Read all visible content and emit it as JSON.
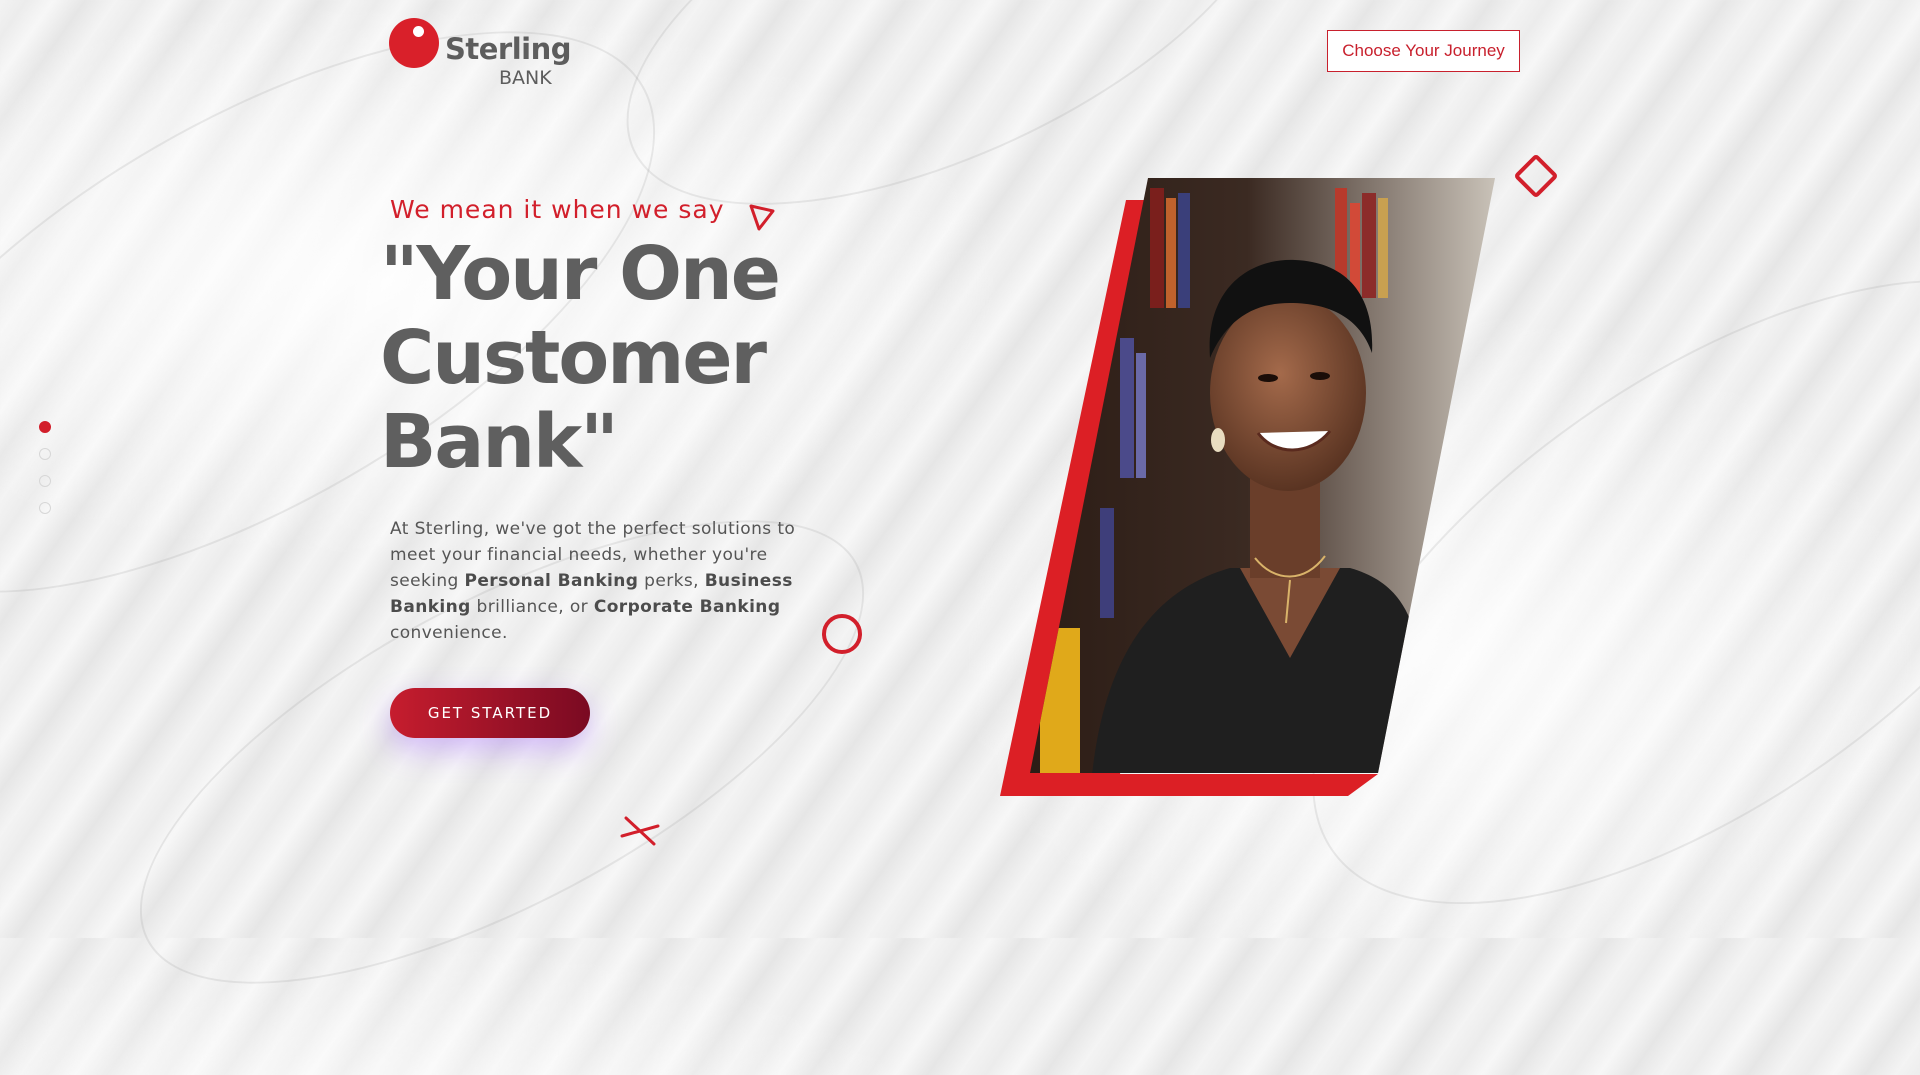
{
  "brand": {
    "name": "Sterling",
    "sub": "BANK"
  },
  "header": {
    "journey_button": "Choose Your Journey"
  },
  "hero": {
    "tagline": "We mean it when we say",
    "headline_line1": "\"Your One",
    "headline_line2": "Customer",
    "headline_line3": "Bank\"",
    "desc_1": "At Sterling, we've got the perfect solutions to meet your financial needs, whether you're seeking ",
    "desc_bold_1": "Personal Banking",
    "desc_2": " perks, ",
    "desc_bold_2": "Business Banking",
    "desc_3": " brilliance, or ",
    "desc_bold_3": "Corporate Banking",
    "desc_4": " convenience.",
    "cta": "GET STARTED"
  },
  "slider": {
    "total": 4,
    "active_index": 0
  },
  "colors": {
    "brand_red": "#d21f2b",
    "text_gray": "#5f5f5f"
  },
  "icons": [
    "triangle-outline-icon",
    "diamond-outline-icon",
    "ring-outline-icon",
    "cross-icon"
  ]
}
